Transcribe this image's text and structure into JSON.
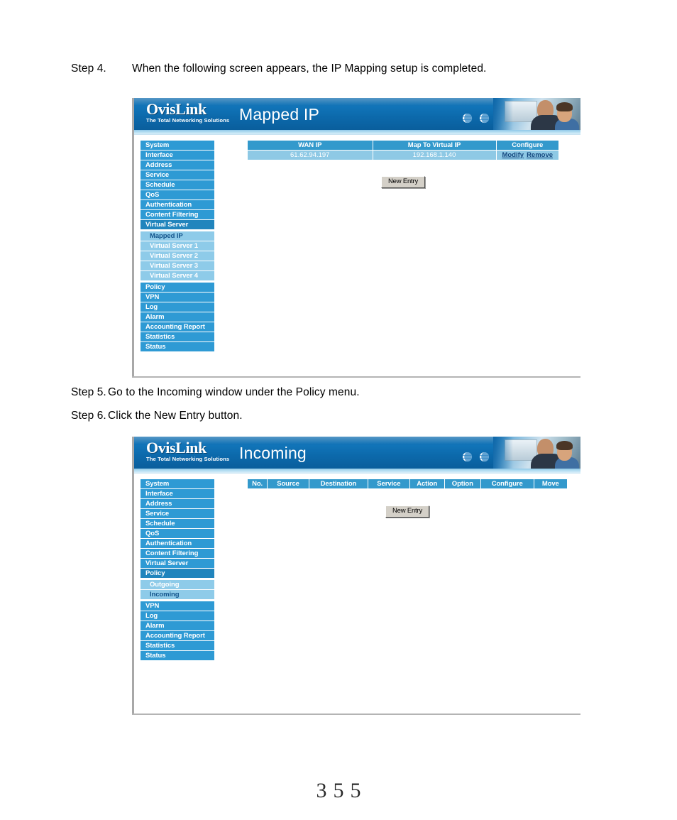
{
  "document": {
    "steps": [
      {
        "label": "Step 4.",
        "text": "When the following screen appears, the IP Mapping setup is completed."
      },
      {
        "label": "Step 5.",
        "text": "Go to the Incoming window under the Policy menu."
      },
      {
        "label": "Step 6.",
        "text": "Click the New Entry button."
      }
    ],
    "page_number": "355"
  },
  "brand": {
    "name": "OvisLink",
    "tagline": "The Total Networking Solutions"
  },
  "colors": {
    "banner_blue": "#0d6aad",
    "nav_blue": "#2e9ad4",
    "nav_selected": "#2185bd",
    "nav_sub_blue": "#8ecbe9",
    "table_header": "#3399cc",
    "table_row": "#8ec9e5",
    "link_blue": "#15477e",
    "button_face": "#d4d0c8"
  },
  "screenshot_mapped_ip": {
    "title": "Mapped IP",
    "sidebar": [
      {
        "label": "System",
        "type": "item",
        "selected": false
      },
      {
        "label": "Interface",
        "type": "item",
        "selected": false
      },
      {
        "label": "Address",
        "type": "item",
        "selected": false
      },
      {
        "label": "Service",
        "type": "item",
        "selected": false
      },
      {
        "label": "Schedule",
        "type": "item",
        "selected": false
      },
      {
        "label": "QoS",
        "type": "item",
        "selected": false
      },
      {
        "label": "Authentication",
        "type": "item",
        "selected": false
      },
      {
        "label": "Content Filtering",
        "type": "item",
        "selected": false
      },
      {
        "label": "Virtual Server",
        "type": "item",
        "selected": true
      },
      {
        "label": "Mapped IP",
        "type": "sub",
        "selected": true
      },
      {
        "label": "Virtual Server 1",
        "type": "sub",
        "selected": false
      },
      {
        "label": "Virtual Server 2",
        "type": "sub",
        "selected": false
      },
      {
        "label": "Virtual Server 3",
        "type": "sub",
        "selected": false
      },
      {
        "label": "Virtual Server 4",
        "type": "sub",
        "selected": false
      },
      {
        "label": "Policy",
        "type": "item",
        "selected": false
      },
      {
        "label": "VPN",
        "type": "item",
        "selected": false
      },
      {
        "label": "Log",
        "type": "item",
        "selected": false
      },
      {
        "label": "Alarm",
        "type": "item",
        "selected": false
      },
      {
        "label": "Accounting Report",
        "type": "item",
        "selected": false
      },
      {
        "label": "Statistics",
        "type": "item",
        "selected": false
      },
      {
        "label": "Status",
        "type": "item",
        "selected": false
      }
    ],
    "table": {
      "headers": [
        "WAN IP",
        "Map To Virtual IP",
        "Configure"
      ],
      "rows": [
        {
          "wan_ip": "61.62.94.197",
          "virtual_ip": "192.168.1.140",
          "modify": "Modify",
          "remove": "Remove"
        }
      ]
    },
    "new_entry_button": "New Entry"
  },
  "screenshot_incoming": {
    "title": "Incoming",
    "sidebar": [
      {
        "label": "System",
        "type": "item",
        "selected": false
      },
      {
        "label": "Interface",
        "type": "item",
        "selected": false
      },
      {
        "label": "Address",
        "type": "item",
        "selected": false
      },
      {
        "label": "Service",
        "type": "item",
        "selected": false
      },
      {
        "label": "Schedule",
        "type": "item",
        "selected": false
      },
      {
        "label": "QoS",
        "type": "item",
        "selected": false
      },
      {
        "label": "Authentication",
        "type": "item",
        "selected": false
      },
      {
        "label": "Content Filtering",
        "type": "item",
        "selected": false
      },
      {
        "label": "Virtual Server",
        "type": "item",
        "selected": false
      },
      {
        "label": "Policy",
        "type": "item",
        "selected": true
      },
      {
        "label": "Outgoing",
        "type": "sub",
        "selected": false
      },
      {
        "label": "Incoming",
        "type": "sub",
        "selected": true
      },
      {
        "label": "VPN",
        "type": "item",
        "selected": false
      },
      {
        "label": "Log",
        "type": "item",
        "selected": false
      },
      {
        "label": "Alarm",
        "type": "item",
        "selected": false
      },
      {
        "label": "Accounting Report",
        "type": "item",
        "selected": false
      },
      {
        "label": "Statistics",
        "type": "item",
        "selected": false
      },
      {
        "label": "Status",
        "type": "item",
        "selected": false
      }
    ],
    "table": {
      "headers": [
        "No.",
        "Source",
        "Destination",
        "Service",
        "Action",
        "Option",
        "Configure",
        "Move"
      ],
      "rows": []
    },
    "new_entry_button": "New Entry"
  },
  "icons": {
    "globe": "globe-icon",
    "photo": "people-at-computer-photo"
  }
}
